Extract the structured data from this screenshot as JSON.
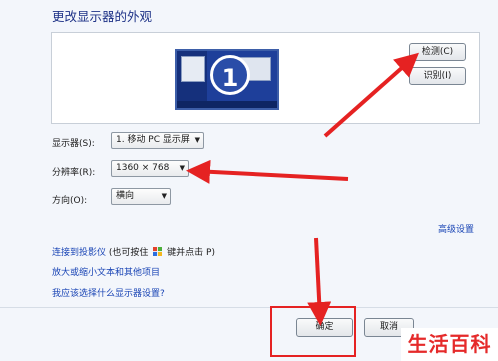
{
  "page_title": "更改显示器的外观",
  "monitor": {
    "number": "1"
  },
  "buttons": {
    "detect": "检测(C)",
    "identify": "识别(I)",
    "ok": "确定",
    "cancel": "取消"
  },
  "form": {
    "display_label": "显示器(S):",
    "display_value": "1. 移动 PC 显示屏",
    "resolution_label": "分辨率(R):",
    "resolution_value": "1360 × 768",
    "orientation_label": "方向(O):",
    "orientation_value": "横向"
  },
  "links": {
    "advanced": "高级设置",
    "projector": "连接到投影仪",
    "projector_note_prefix": "(也可按住",
    "projector_note_suffix": "键并点击 P)",
    "text_size": "放大或缩小文本和其他项目",
    "which_settings": "我应该选择什么显示器设置?"
  },
  "watermark": "生活百科",
  "colors": {
    "title": "#1e3287",
    "link": "#1a45b5",
    "annotation_red": "#e52222",
    "window_bg": "#f3f6fb"
  }
}
